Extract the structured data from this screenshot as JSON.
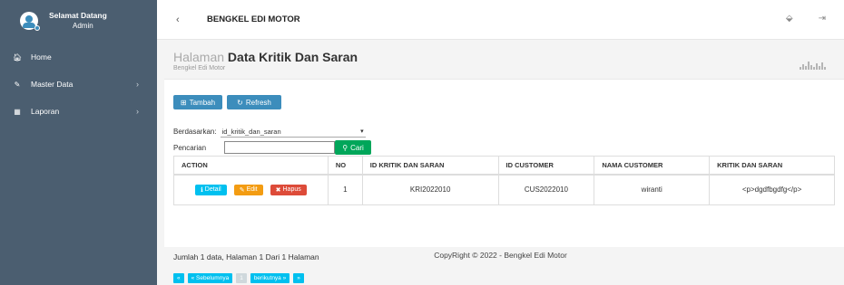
{
  "sidebar": {
    "greeting": "Selamat Datang",
    "role": "Admin",
    "items": [
      {
        "label": "Home",
        "icon": "home-icon"
      },
      {
        "label": "Master Data",
        "icon": "edit-icon"
      },
      {
        "label": "Laporan",
        "icon": "calendar-icon"
      }
    ]
  },
  "topbar": {
    "title": "BENGKEL EDI MOTOR"
  },
  "header": {
    "light": "Halaman",
    "bold": "Data Kritik Dan Saran",
    "subtitle": "Bengkel Edi Motor"
  },
  "toolbar": {
    "tambah": "Tambah",
    "refresh": "Refresh"
  },
  "filter": {
    "label": "Berdasarkan:",
    "selected": "id_kritik_dan_saran",
    "search_label": "Pencarian",
    "search_value": "",
    "search_button": "Cari"
  },
  "table": {
    "columns": [
      "ACTION",
      "NO",
      "ID KRITIK DAN SARAN",
      "ID CUSTOMER",
      "NAMA CUSTOMER",
      "KRITIK DAN SARAN"
    ],
    "actions": {
      "detail": "Detail",
      "edit": "Edit",
      "hapus": "Hapus"
    },
    "rows": [
      {
        "no": "1",
        "id_kritik": "KRI2022010",
        "id_customer": "CUS2022010",
        "nama": "wiranti",
        "kritik": "<p>dgdfbgdfg</p>"
      }
    ]
  },
  "summary": "Jumlah 1 data, Halaman 1 Dari 1 Halaman",
  "pager": {
    "first": "«",
    "prev": "« Sebelumnya",
    "current": "1",
    "next": "berikutnya »",
    "last": "»"
  },
  "footer": "CopyRight © 2022 - Bengkel Edi Motor",
  "colors": {
    "sidebar": "#4b5e70",
    "primary": "#3c8dbc",
    "success": "#00a65a",
    "info": "#00c0ef",
    "warning": "#f39c12",
    "danger": "#dd4b39"
  }
}
